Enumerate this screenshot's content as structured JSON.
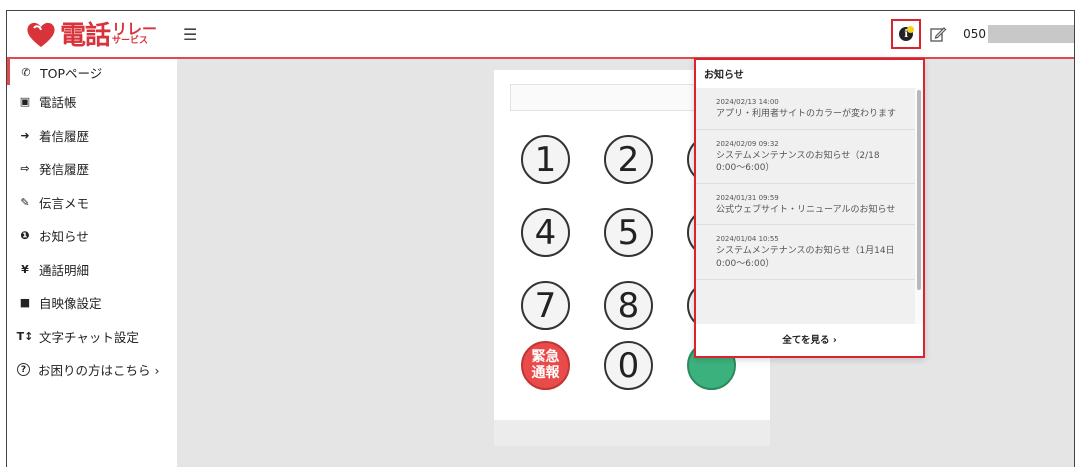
{
  "colors": {
    "brand": "#d8323b",
    "accent_border": "#d9232f",
    "emergency": "#e94a4a",
    "call": "#3bb27d"
  },
  "logo": {
    "kanji": "電話",
    "kana_top": "リレー",
    "kana_bottom": "サービス"
  },
  "header": {
    "phone_prefix": "050",
    "menu_icon": "hamburger-icon",
    "info_icon": "info-icon",
    "edit_icon": "edit-icon"
  },
  "sidebar": {
    "items": [
      {
        "label": "TOPページ",
        "icon": "phone-icon",
        "glyph": "✆"
      },
      {
        "label": "電話帳",
        "icon": "contact-book-icon",
        "glyph": "▣"
      },
      {
        "label": "着信履歴",
        "icon": "incoming-call-icon",
        "glyph": "➜"
      },
      {
        "label": "発信履歴",
        "icon": "outgoing-call-icon",
        "glyph": "⇨"
      },
      {
        "label": "伝言メモ",
        "icon": "memo-edit-icon",
        "glyph": "✎"
      },
      {
        "label": "お知らせ",
        "icon": "info-icon",
        "glyph": "❶"
      },
      {
        "label": "通話明細",
        "icon": "yen-icon",
        "glyph": "¥"
      },
      {
        "label": "自映像設定",
        "icon": "video-camera-icon",
        "glyph": "■"
      },
      {
        "label": "文字チャット設定",
        "icon": "text-size-icon",
        "glyph": "T↕"
      },
      {
        "label": "お困りの方はこちら ›",
        "icon": "help-icon",
        "glyph": "?"
      }
    ]
  },
  "dialpad": {
    "keys": [
      "1",
      "2",
      "4",
      "5",
      "7",
      "8",
      "0"
    ],
    "emergency_line1": "緊急",
    "emergency_line2": "通報"
  },
  "notifications": {
    "title": "お知らせ",
    "items": [
      {
        "date": "2024/02/13 14:00",
        "text": "アプリ・利用者サイトのカラーが変わります"
      },
      {
        "date": "2024/02/09 09:32",
        "text": "システムメンテナンスのお知らせ（2/18 0:00〜6:00）"
      },
      {
        "date": "2024/01/31 09:59",
        "text": "公式ウェブサイト・リニューアルのお知らせ"
      },
      {
        "date": "2024/01/04 10:55",
        "text": "システムメンテナンスのお知らせ（1月14日 0:00〜6:00）"
      }
    ],
    "see_all": "全てを見る ›"
  }
}
